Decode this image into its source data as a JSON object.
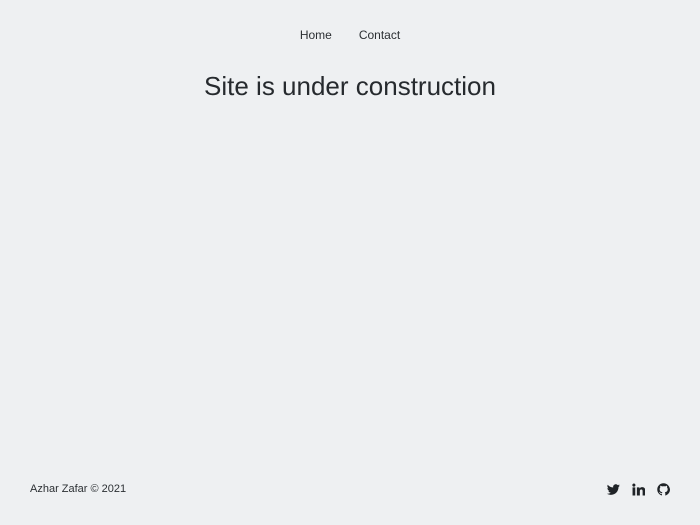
{
  "nav": {
    "items": [
      {
        "label": "Home"
      },
      {
        "label": "Contact"
      }
    ]
  },
  "main": {
    "headline": "Site is under construction"
  },
  "footer": {
    "copyright": "Azhar Zafar © 2021",
    "social": [
      {
        "icon": "twitter-icon"
      },
      {
        "icon": "linkedin-icon"
      },
      {
        "icon": "github-icon"
      }
    ]
  },
  "colors": {
    "background": "#eef0f2",
    "text": "#2b2f33"
  }
}
